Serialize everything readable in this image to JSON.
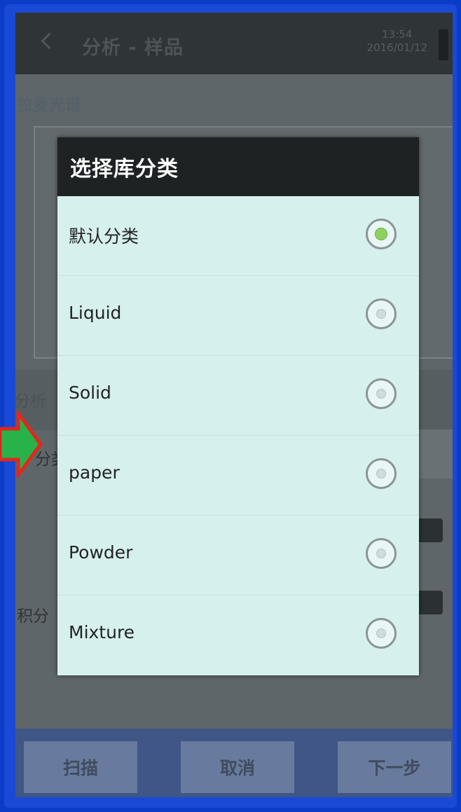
{
  "app": {
    "title": "分析 - 样品",
    "time": "13:54",
    "date": "2016/01/12"
  },
  "background": {
    "section_title": "拉曼光谱",
    "label_analysis": "分析",
    "label_category": "分类",
    "label_integral": "积分"
  },
  "bottom_bar": {
    "scan_label": "扫描",
    "cancel_label": "取消",
    "next_label": "下一步"
  },
  "dialog": {
    "title": "选择库分类",
    "selected_option": "默认分类",
    "options": [
      {
        "label": "默认分类",
        "checked": true
      },
      {
        "label": "Liquid",
        "checked": false
      },
      {
        "label": "Solid",
        "checked": false
      },
      {
        "label": "paper",
        "checked": false
      },
      {
        "label": "Powder",
        "checked": false
      },
      {
        "label": "Mixture",
        "checked": false
      }
    ]
  },
  "icons": {
    "back": "back-chevron-icon",
    "battery": "battery-icon",
    "radio": "radio-button-icon",
    "overlay_arrow": "pointer-arrow-icon"
  },
  "colors": {
    "frame": "#1a49d6",
    "dialog_header": "#1e2223",
    "dialog_body": "#d6f0ee",
    "radio_selected": "#8ed25d",
    "arrow_fill": "#27b34a",
    "arrow_outline": "#e0281c"
  }
}
